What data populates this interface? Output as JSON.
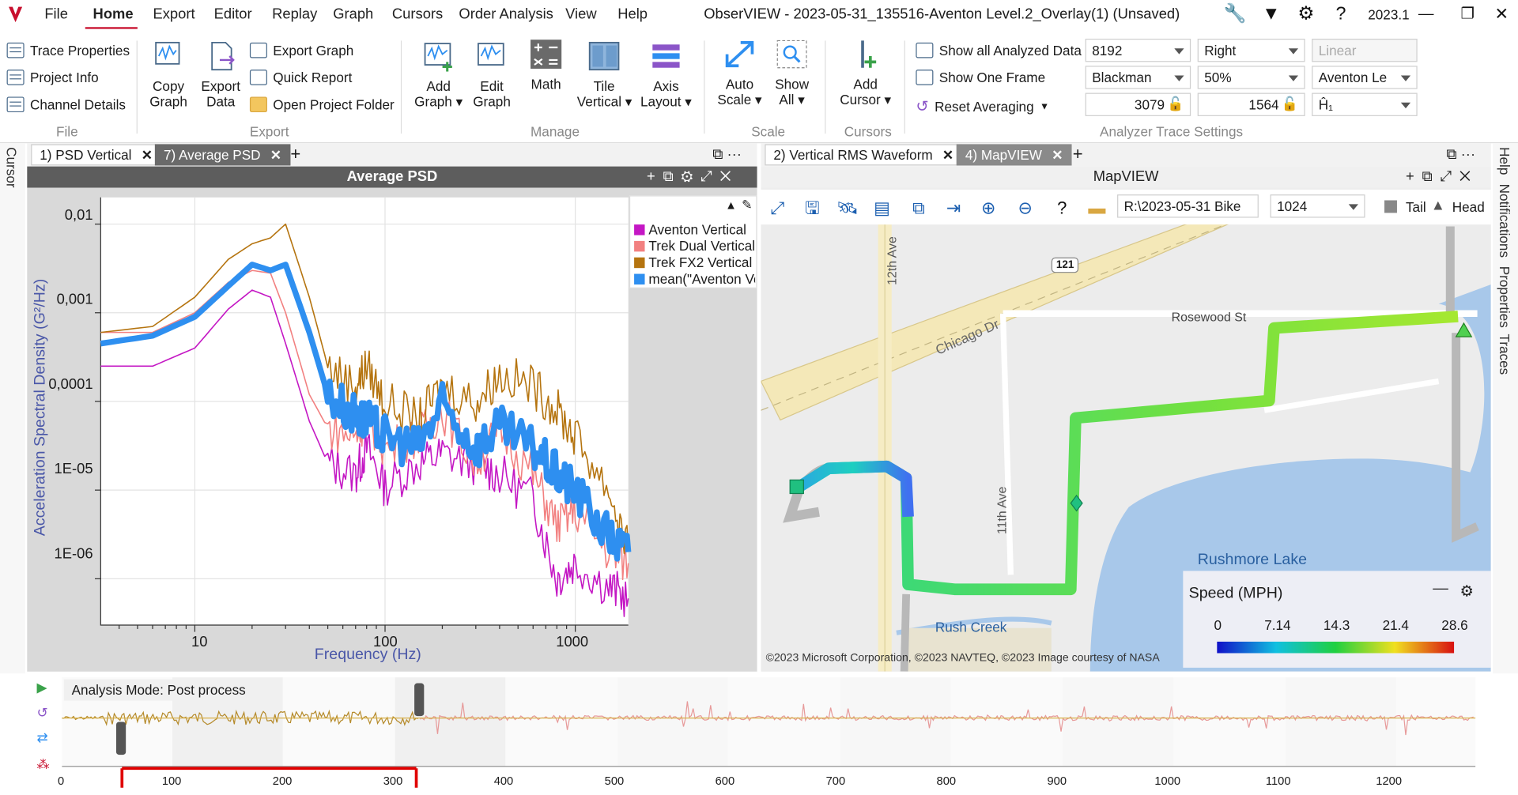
{
  "window": {
    "title": "ObserVIEW - 2023-05-31_135516-Aventon Level.2_Overlay(1) (Unsaved)",
    "version": "2023.1"
  },
  "menu": [
    "File",
    "Home",
    "Export",
    "Editor",
    "Replay",
    "Graph",
    "Cursors",
    "Order Analysis",
    "View",
    "Help"
  ],
  "ribbon": {
    "file": {
      "label": "File",
      "items": [
        "Trace Properties",
        "Project Info",
        "Channel Details"
      ]
    },
    "export": {
      "label": "Export",
      "big": [
        "Copy\nGraph",
        "Export\nData"
      ],
      "items": [
        "Export Graph",
        "Quick Report",
        "Open Project Folder"
      ]
    },
    "manage": {
      "label": "Manage",
      "big": [
        "Add\nGraph ▾",
        "Edit\nGraph",
        "Math",
        "Tile\nVertical ▾",
        "Axis\nLayout ▾"
      ]
    },
    "scale": {
      "label": "Scale",
      "big": [
        "Auto\nScale ▾",
        "Show\nAll ▾"
      ]
    },
    "cursors": {
      "label": "Cursors",
      "big": [
        "Add\nCursor ▾"
      ]
    },
    "analyzer": {
      "label": "Analyzer Trace Settings",
      "items": [
        "Show all Analyzed Data",
        "Show One Frame",
        "Reset Averaging"
      ],
      "combos": [
        "8192",
        "Right",
        "Linear",
        "Blackman",
        "50%",
        "Aventon Le",
        "3079",
        "1564",
        "Ĥ₁"
      ]
    }
  },
  "left_tabs": [
    {
      "label": "1) PSD Vertical"
    },
    {
      "label": "7) Average PSD"
    }
  ],
  "right_tabs": [
    {
      "label": "2) Vertical RMS Waveform"
    },
    {
      "label": "4) MapVIEW"
    }
  ],
  "psd": {
    "title": "Average PSD",
    "legend": [
      "Aventon Vertical",
      "Trek Dual Vertical",
      "Trek FX2 Vertical",
      "mean(\"Aventon Ve"
    ],
    "colors": [
      "#c417c4",
      "#f28080",
      "#b5740f",
      "#2e8ff0"
    ]
  },
  "chart_data": {
    "type": "line",
    "xlabel": "Frequency (Hz)",
    "ylabel": "Acceleration Spectral Density (G²/Hz)",
    "x_scale": "log",
    "y_scale": "log",
    "x_ticks": [
      "10",
      "100",
      "1000"
    ],
    "y_ticks": [
      "0,01",
      "0,001",
      "0,0001",
      "1E-05",
      "1E-06"
    ],
    "xlim": [
      3.2,
      1900
    ],
    "ylim": [
      3e-07,
      0.02
    ],
    "series": [
      {
        "name": "Aventon Vertical",
        "x": [
          3.2,
          6,
          10,
          15,
          20,
          25,
          30,
          40,
          50,
          70,
          80,
          100,
          150,
          200,
          300,
          400,
          600,
          800,
          1000,
          1500,
          1900
        ],
        "y": [
          0.00025,
          0.00025,
          0.0004,
          0.0011,
          0.0018,
          0.0015,
          0.00045,
          6e-05,
          2e-05,
          1.5e-05,
          3e-05,
          1.1e-05,
          2e-05,
          2.5e-05,
          2e-05,
          1.5e-05,
          8e-06,
          1e-06,
          1.5e-06,
          8e-07,
          6e-07
        ]
      },
      {
        "name": "Trek Dual Vertical",
        "x": [
          3.2,
          6,
          10,
          15,
          20,
          25,
          30,
          40,
          50,
          70,
          80,
          100,
          150,
          200,
          300,
          400,
          600,
          800,
          1000,
          1500,
          1900
        ],
        "y": [
          0.0006,
          0.0006,
          0.001,
          0.0022,
          0.003,
          0.0028,
          0.001,
          0.00012,
          5e-05,
          4e-05,
          7e-05,
          3e-05,
          4e-05,
          8e-05,
          2e-05,
          5e-05,
          1.5e-05,
          4e-06,
          6e-06,
          2e-06,
          1.5e-06
        ]
      },
      {
        "name": "Trek FX2 Vertical",
        "x": [
          3.2,
          6,
          10,
          15,
          20,
          25,
          30,
          40,
          50,
          70,
          80,
          100,
          150,
          200,
          300,
          400,
          600,
          800,
          1000,
          1500,
          1900
        ],
        "y": [
          0.0006,
          0.0007,
          0.0015,
          0.004,
          0.006,
          0.007,
          0.01,
          0.0015,
          0.00025,
          0.00015,
          0.00025,
          0.0001,
          6e-05,
          0.00015,
          0.0001,
          0.0002,
          0.00015,
          8e-05,
          4e-05,
          1e-05,
          2e-06
        ]
      },
      {
        "name": "mean(\"Aventon Ve",
        "x": [
          3.2,
          6,
          10,
          15,
          20,
          25,
          30,
          40,
          50,
          70,
          80,
          100,
          150,
          200,
          300,
          400,
          600,
          800,
          1000,
          1500,
          1900
        ],
        "y": [
          0.00045,
          0.00055,
          0.0009,
          0.002,
          0.0035,
          0.003,
          0.0035,
          0.0006,
          0.00012,
          7e-05,
          6e-05,
          4e-05,
          3e-05,
          9e-05,
          3e-05,
          5e-05,
          3e-05,
          1.5e-05,
          1e-05,
          3e-06,
          2e-06
        ]
      }
    ]
  },
  "map": {
    "title": "MapVIEW",
    "path_input": "R:\\2023-05-31 Bike",
    "points_combo": "1024",
    "tail_label": "Tail",
    "head_label": "Head",
    "labels": {
      "rosewood": "Rosewood St",
      "chicago": "Chicago Dr",
      "ave12": "12th Ave",
      "ave11": "11th Ave",
      "rush_creek": "Rush Creek",
      "lake": "Rushmore Lake",
      "route": "121"
    },
    "speed_title": "Speed (MPH)",
    "speed_ticks": [
      "0",
      "7.14",
      "14.3",
      "21.4",
      "28.6"
    ],
    "copyright": "©2023 Microsoft Corporation, ©2023 NAVTEQ, ©2023 Image courtesy of NASA"
  },
  "side_panels": [
    "Help",
    "Notifications",
    "Properties",
    "Traces"
  ],
  "left_side": "Cursor",
  "timeline": {
    "mode": "Analysis Mode: Post process",
    "ticks": [
      "0",
      "100",
      "200",
      "300",
      "400",
      "500",
      "600",
      "700",
      "800",
      "900",
      "1000",
      "1100",
      "1200"
    ]
  }
}
